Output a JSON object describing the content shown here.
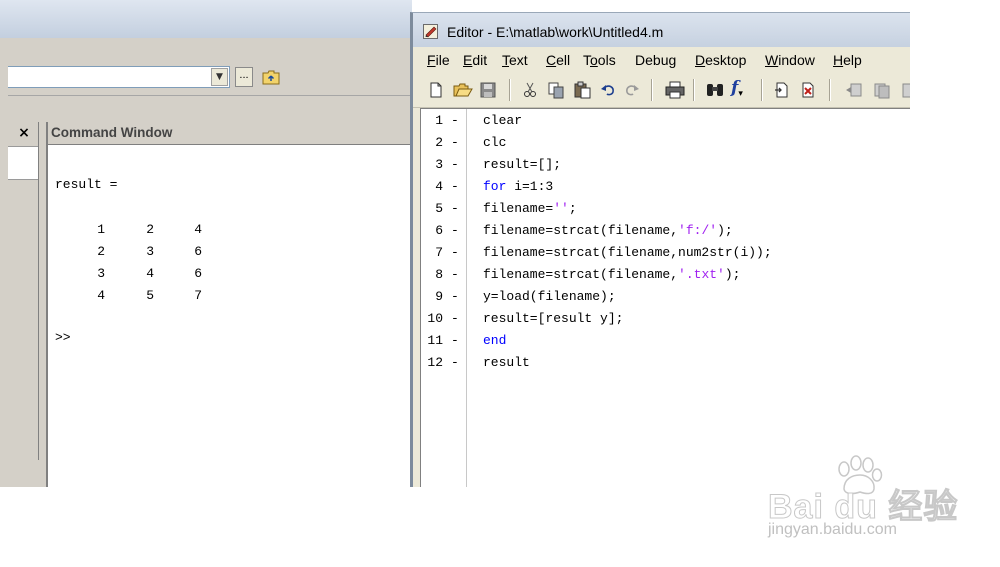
{
  "editor": {
    "title": "Editor - E:\\matlab\\work\\Untitled4.m",
    "menus": [
      "File",
      "Edit",
      "Text",
      "Cell",
      "Tools",
      "Debug",
      "Desktop",
      "Window",
      "Help"
    ],
    "toolbar_icons": [
      "new-file-icon",
      "open-folder-icon",
      "save-icon",
      "cut-icon",
      "copy-icon",
      "paste-icon",
      "undo-icon",
      "redo-icon",
      "print-icon",
      "find-icon",
      "function-icon",
      "insert-cell-icon",
      "remove-cell-icon",
      "cell-prev-icon",
      "cell-next-icon"
    ],
    "lines": [
      {
        "num": "1",
        "mark": "-",
        "code": [
          {
            "t": "clear",
            "c": "plain"
          }
        ]
      },
      {
        "num": "2",
        "mark": "-",
        "code": [
          {
            "t": "clc",
            "c": "plain"
          }
        ]
      },
      {
        "num": "3",
        "mark": "-",
        "code": [
          {
            "t": "result=[];",
            "c": "plain"
          }
        ]
      },
      {
        "num": "4",
        "mark": "-",
        "code": [
          {
            "t": "for",
            "c": "kw"
          },
          {
            "t": " i=1:3",
            "c": "plain"
          }
        ]
      },
      {
        "num": "5",
        "mark": "-",
        "code": [
          {
            "t": "filename=",
            "c": "plain"
          },
          {
            "t": "''",
            "c": "str"
          },
          {
            "t": ";",
            "c": "plain"
          }
        ]
      },
      {
        "num": "6",
        "mark": "-",
        "code": [
          {
            "t": "filename=strcat(filename,",
            "c": "plain"
          },
          {
            "t": "'f:/'",
            "c": "str"
          },
          {
            "t": ");",
            "c": "plain"
          }
        ]
      },
      {
        "num": "7",
        "mark": "-",
        "code": [
          {
            "t": "filename=strcat(filename,num2str(i));",
            "c": "plain"
          }
        ]
      },
      {
        "num": "8",
        "mark": "-",
        "code": [
          {
            "t": "filename=strcat(filename,",
            "c": "plain"
          },
          {
            "t": "'.txt'",
            "c": "str"
          },
          {
            "t": ");",
            "c": "plain"
          }
        ]
      },
      {
        "num": "9",
        "mark": "-",
        "code": [
          {
            "t": "y=load(filename);",
            "c": "plain"
          }
        ]
      },
      {
        "num": "10",
        "mark": "-",
        "code": [
          {
            "t": "result=[result y];",
            "c": "plain"
          }
        ]
      },
      {
        "num": "11",
        "mark": "-",
        "code": [
          {
            "t": "end",
            "c": "kw"
          }
        ]
      },
      {
        "num": "12",
        "mark": "-",
        "code": [
          {
            "t": "result",
            "c": "plain"
          }
        ]
      }
    ]
  },
  "left_panel": {
    "close_glyph": "×",
    "browse_label": "..."
  },
  "command_window": {
    "title": "Command Window",
    "result_label": "result =",
    "matrix": [
      [
        1,
        2,
        4
      ],
      [
        2,
        3,
        6
      ],
      [
        3,
        4,
        6
      ],
      [
        4,
        5,
        7
      ]
    ],
    "prompt": ">>"
  },
  "watermark": {
    "logo_text": "Bai du 经验",
    "url": "jingyan.baidu.com"
  },
  "colors": {
    "keyword": "#0000ff",
    "string": "#a020f0",
    "chrome": "#d4d0c8",
    "editor_title_bg": "#c6d1e0"
  }
}
